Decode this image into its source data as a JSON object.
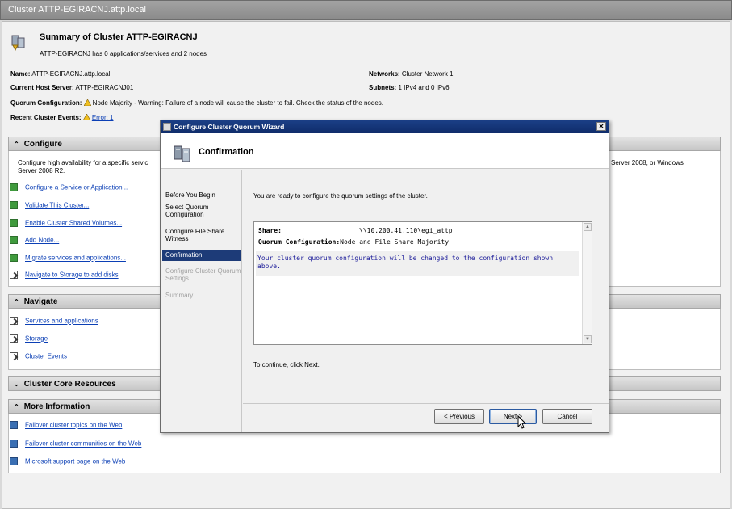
{
  "window": {
    "title": "Cluster ATTP-EGIRACNJ.attp.local"
  },
  "summary": {
    "title": "Summary of Cluster ATTP-EGIRACNJ",
    "subtitle": "ATTP-EGIRACNJ has 0 applications/services and 2 nodes",
    "name_label": "Name:",
    "name_value": "ATTP-EGIRACNJ.attp.local",
    "host_label": "Current Host Server:",
    "host_value": "ATTP-EGIRACNJ01",
    "quorum_label": "Quorum Configuration:",
    "quorum_value": "Node Majority - Warning: Failure of a node will cause the cluster to fail. Check the status of the nodes.",
    "events_label": "Recent Cluster Events:",
    "events_value": "Error: 1",
    "networks_label": "Networks:",
    "networks_value": "Cluster Network 1",
    "subnets_label": "Subnets:",
    "subnets_value": "1 IPv4 and 0 IPv6"
  },
  "configure": {
    "header": "Configure",
    "desc": "Configure high availability for a specific servic",
    "desc2": "Server 2008 R2.",
    "desc_right": "Server 2008, or Windows",
    "items": [
      "Configure a Service or Application...",
      "Validate This Cluster...",
      "Enable Cluster Shared Volumes...",
      "Add Node...",
      "Migrate services and applications...",
      "Navigate to Storage to add disks"
    ]
  },
  "navigate": {
    "header": "Navigate",
    "items": [
      "Services and applications",
      "Storage",
      "Cluster Events"
    ]
  },
  "core": {
    "header": "Cluster Core Resources"
  },
  "more": {
    "header": "More Information",
    "items": [
      "Failover cluster topics on the Web",
      "Failover cluster communities on the Web",
      "Microsoft support page on the Web"
    ]
  },
  "dialog": {
    "title": "Configure Cluster Quorum Wizard",
    "close": "✕",
    "heading": "Confirmation",
    "steps": [
      "Before You Begin",
      "Select Quorum Configuration",
      "Configure File Share Witness",
      "Confirmation",
      "Configure Cluster Quorum Settings",
      "Summary"
    ],
    "intro": "You are ready to configure the quorum settings of the cluster.",
    "share_label": "Share:",
    "share_value": "\\\\10.200.41.110\\egi_attp",
    "qc_label": "Quorum Configuration:",
    "qc_value": "Node and File Share Majority",
    "note": "Your cluster quorum configuration will be changed to the configuration shown above.",
    "continue": "To continue, click Next.",
    "prev": "< Previous",
    "next": "Next >",
    "cancel": "Cancel"
  },
  "icons": {
    "warning": "warning-icon",
    "cluster": "cluster-icon",
    "cursor": "mouse-pointer"
  }
}
